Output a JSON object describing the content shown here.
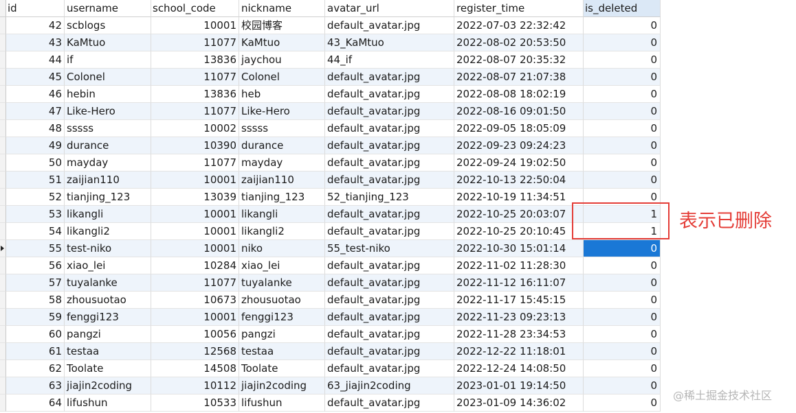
{
  "table": {
    "columns": [
      "id",
      "username",
      "school_code",
      "nickname",
      "avatar_url",
      "register_time",
      "is_deleted"
    ],
    "rows": [
      {
        "id": "42",
        "username": "scblogs",
        "school_code": "10001",
        "nickname": "校园博客",
        "avatar_url": "default_avatar.jpg",
        "register_time": "2022-07-03 22:32:42",
        "is_deleted": "0"
      },
      {
        "id": "43",
        "username": "KaMtuo",
        "school_code": "11077",
        "nickname": "KaMtuo",
        "avatar_url": "43_KaMtuo",
        "register_time": "2022-08-02 20:53:50",
        "is_deleted": "0"
      },
      {
        "id": "44",
        "username": "if",
        "school_code": "13836",
        "nickname": "jaychou",
        "avatar_url": "44_if",
        "register_time": "2022-08-07 20:35:32",
        "is_deleted": "0"
      },
      {
        "id": "45",
        "username": "Colonel",
        "school_code": "11077",
        "nickname": "Colonel",
        "avatar_url": "default_avatar.jpg",
        "register_time": "2022-08-07 21:07:38",
        "is_deleted": "0"
      },
      {
        "id": "46",
        "username": "hebin",
        "school_code": "13836",
        "nickname": "heb",
        "avatar_url": "default_avatar.jpg",
        "register_time": "2022-08-08 18:02:19",
        "is_deleted": "0"
      },
      {
        "id": "47",
        "username": "Like-Hero",
        "school_code": "11077",
        "nickname": "Like-Hero",
        "avatar_url": "default_avatar.jpg",
        "register_time": "2022-08-16 09:01:50",
        "is_deleted": "0"
      },
      {
        "id": "48",
        "username": "sssss",
        "school_code": "10002",
        "nickname": "sssss",
        "avatar_url": "default_avatar.jpg",
        "register_time": "2022-09-05 18:05:09",
        "is_deleted": "0"
      },
      {
        "id": "49",
        "username": "durance",
        "school_code": "10390",
        "nickname": "durance",
        "avatar_url": "default_avatar.jpg",
        "register_time": "2022-09-23 09:24:23",
        "is_deleted": "0"
      },
      {
        "id": "50",
        "username": "mayday",
        "school_code": "11077",
        "nickname": "mayday",
        "avatar_url": "default_avatar.jpg",
        "register_time": "2022-09-24 19:02:50",
        "is_deleted": "0"
      },
      {
        "id": "51",
        "username": "zaijian110",
        "school_code": "10001",
        "nickname": "zaijian110",
        "avatar_url": "default_avatar.jpg",
        "register_time": "2022-10-13 22:50:04",
        "is_deleted": "0"
      },
      {
        "id": "52",
        "username": "tianjing_123",
        "school_code": "13039",
        "nickname": "tianjing_123",
        "avatar_url": "52_tianjing_123",
        "register_time": "2022-10-19 11:34:51",
        "is_deleted": "0"
      },
      {
        "id": "53",
        "username": "likangli",
        "school_code": "10001",
        "nickname": "likangli",
        "avatar_url": "default_avatar.jpg",
        "register_time": "2022-10-25 20:03:07",
        "is_deleted": "1"
      },
      {
        "id": "54",
        "username": "likangli2",
        "school_code": "10001",
        "nickname": "likangli2",
        "avatar_url": "default_avatar.jpg",
        "register_time": "2022-10-25 20:10:45",
        "is_deleted": "1"
      },
      {
        "id": "55",
        "username": "test-niko",
        "school_code": "10001",
        "nickname": "niko",
        "avatar_url": "55_test-niko",
        "register_time": "2022-10-30 15:01:14",
        "is_deleted": "0"
      },
      {
        "id": "56",
        "username": "xiao_lei",
        "school_code": "10284",
        "nickname": "xiao_lei",
        "avatar_url": "default_avatar.jpg",
        "register_time": "2022-11-02 11:28:30",
        "is_deleted": "0"
      },
      {
        "id": "57",
        "username": "tuyalanke",
        "school_code": "11077",
        "nickname": "tuyalanke",
        "avatar_url": "default_avatar.jpg",
        "register_time": "2022-11-12 16:11:07",
        "is_deleted": "0"
      },
      {
        "id": "58",
        "username": "zhousuotao",
        "school_code": "10673",
        "nickname": "zhousuotao",
        "avatar_url": "default_avatar.jpg",
        "register_time": "2022-11-17 15:45:15",
        "is_deleted": "0"
      },
      {
        "id": "59",
        "username": "fenggi123",
        "school_code": "10001",
        "nickname": "fenggi123",
        "avatar_url": "default_avatar.jpg",
        "register_time": "2022-11-23 09:23:13",
        "is_deleted": "0"
      },
      {
        "id": "60",
        "username": "pangzi",
        "school_code": "10056",
        "nickname": "pangzi",
        "avatar_url": "default_avatar.jpg",
        "register_time": "2022-11-28 23:34:53",
        "is_deleted": "0"
      },
      {
        "id": "61",
        "username": "testaa",
        "school_code": "12568",
        "nickname": "testaa",
        "avatar_url": "default_avatar.jpg",
        "register_time": "2022-12-22 11:18:01",
        "is_deleted": "0"
      },
      {
        "id": "62",
        "username": "Toolate",
        "school_code": "14508",
        "nickname": "Toolate",
        "avatar_url": "default_avatar.jpg",
        "register_time": "2022-12-24 14:08:50",
        "is_deleted": "0"
      },
      {
        "id": "63",
        "username": "jiajin2coding",
        "school_code": "10112",
        "nickname": "jiajin2coding",
        "avatar_url": "63_jiajin2coding",
        "register_time": "2023-01-01 19:14:50",
        "is_deleted": "0"
      },
      {
        "id": "64",
        "username": "lifushun",
        "school_code": "10533",
        "nickname": "lifushun",
        "avatar_url": "default_avatar.jpg",
        "register_time": "2023-01-09 14:36:02",
        "is_deleted": "0"
      }
    ],
    "selected_row_id": "55"
  },
  "annotation": {
    "text": "表示已删除",
    "color": "#e43c36"
  },
  "watermark": {
    "text": "@稀土掘金技术社区"
  },
  "colors": {
    "header_highlight": "#dbe8f6",
    "selection": "#1a78d6",
    "stripe": "#eef4fb"
  }
}
